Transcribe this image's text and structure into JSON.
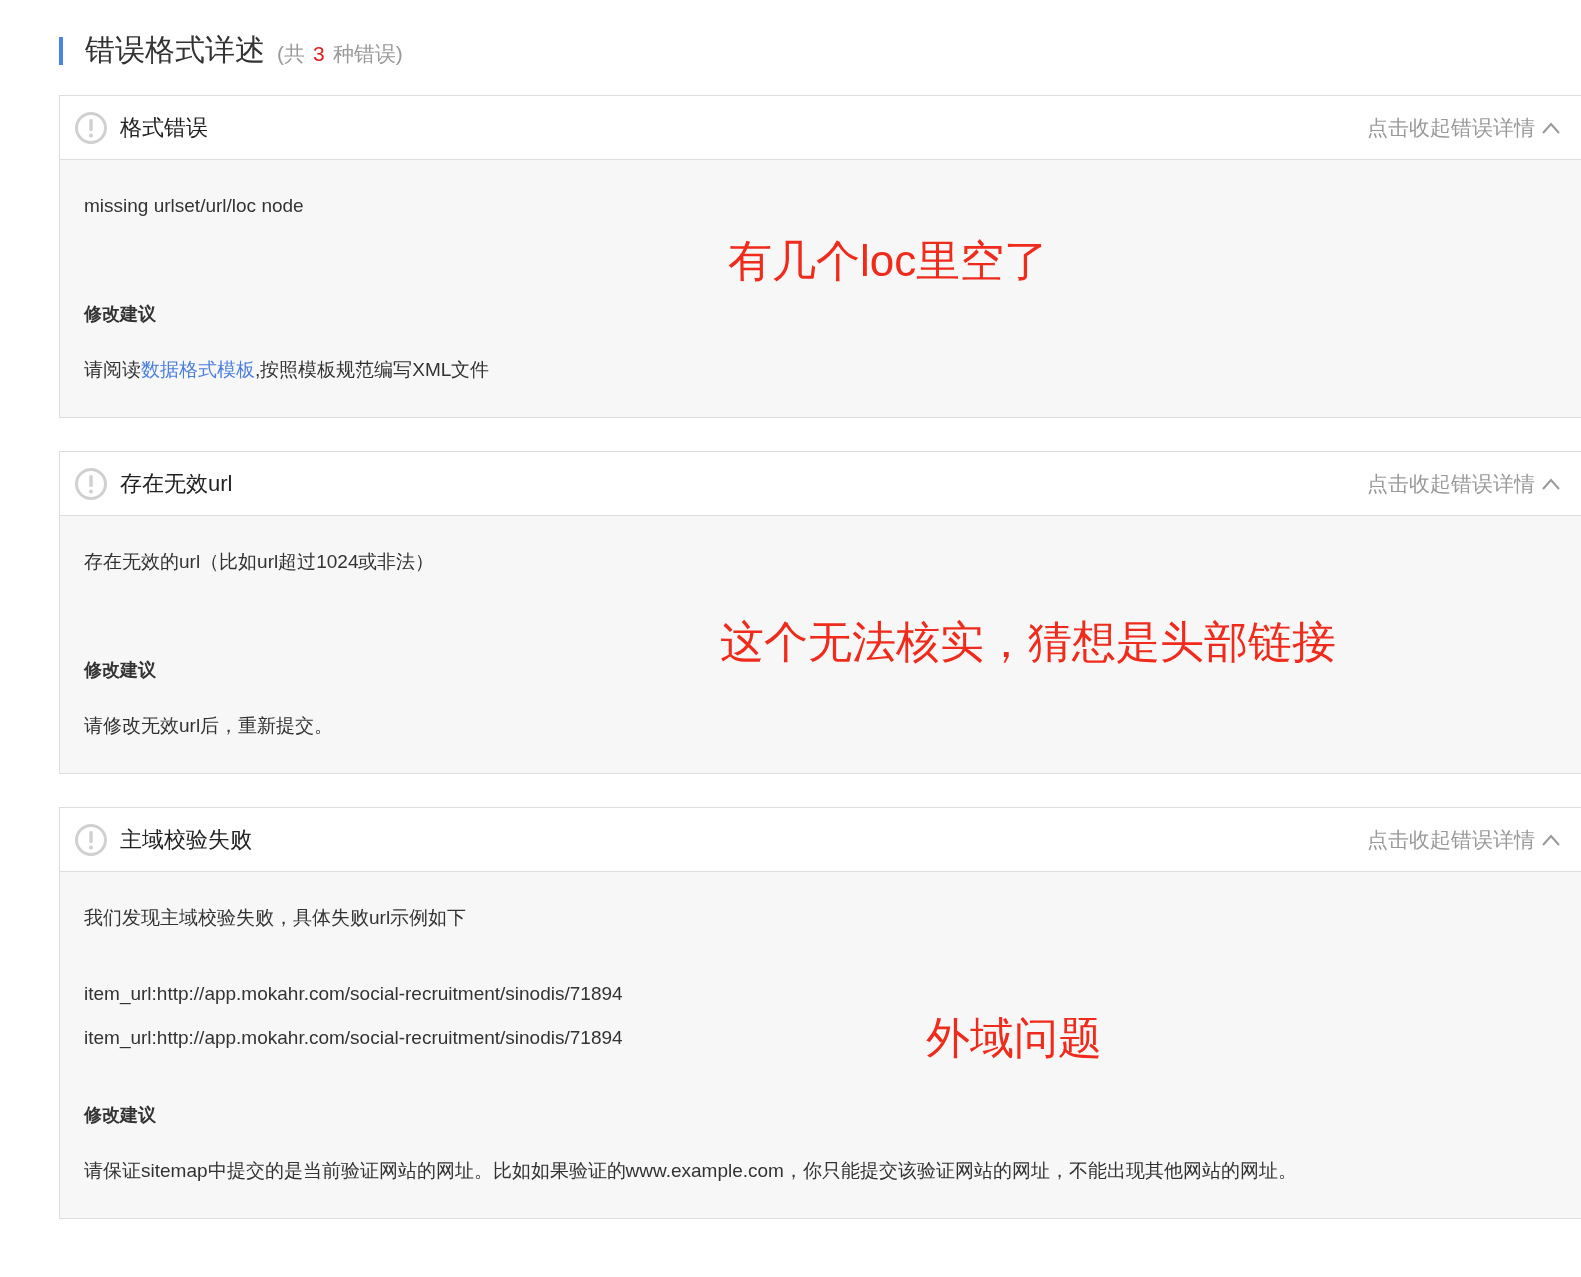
{
  "section": {
    "title": "错误格式详述",
    "count_prefix": "(共",
    "count": "3",
    "count_suffix": "种错误)"
  },
  "errors": [
    {
      "title": "格式错误",
      "toggle": "点击收起错误详情",
      "expanded": true,
      "description": "missing urlset/url/loc node",
      "suggestion_label": "修改建议",
      "suggestion": [
        {
          "kind": "text",
          "text": "请阅读"
        },
        {
          "kind": "link",
          "text": "数据格式模板"
        },
        {
          "kind": "text",
          "text": ",按照模板规范编写XML文件"
        }
      ],
      "annotation": "有几个loc里空了"
    },
    {
      "title": "存在无效url",
      "toggle": "点击收起错误详情",
      "expanded": true,
      "description": "存在无效的url（比如url超过1024或非法）",
      "suggestion_label": "修改建议",
      "suggestion": [
        {
          "kind": "text",
          "text": "请修改无效url后，重新提交。"
        }
      ],
      "annotation": "这个无法核实，猜想是头部链接"
    },
    {
      "title": "主域校验失败",
      "toggle": "点击收起错误详情",
      "expanded": true,
      "description": "我们发现主域校验失败，具体失败url示例如下",
      "examples": [
        "item_url:http://app.mokahr.com/social-recruitment/sinodis/71894",
        "item_url:http://app.mokahr.com/social-recruitment/sinodis/71894"
      ],
      "suggestion_label": "修改建议",
      "suggestion": [
        {
          "kind": "text",
          "text": "请保证sitemap中提交的是当前验证网站的网址。比如如果验证的www.example.com，你只能提交该验证网站的网址，不能出现其他网站的网址。"
        }
      ],
      "annotation": "外域问题"
    }
  ]
}
